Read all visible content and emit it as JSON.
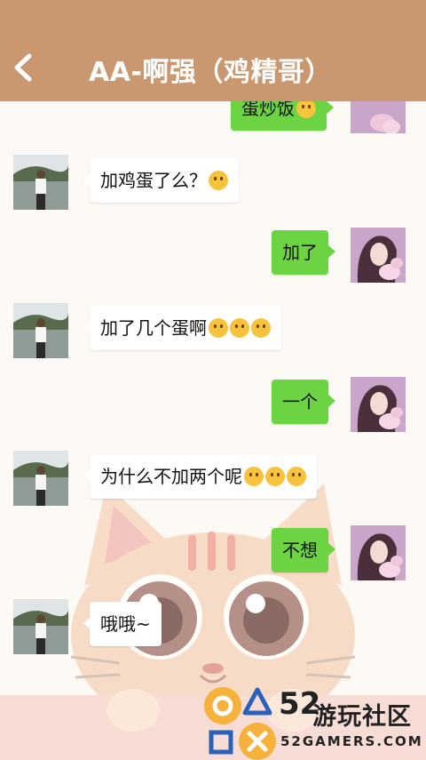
{
  "header": {
    "title": "AA-啊强（鸡精哥）"
  },
  "messages": [
    {
      "side": "right",
      "text": "蛋炒饭"
    },
    {
      "side": "left",
      "text": "加鸡蛋了么？"
    },
    {
      "side": "right",
      "text": "加了"
    },
    {
      "side": "left",
      "text": "加了几个蛋啊"
    },
    {
      "side": "right",
      "text": "一个"
    },
    {
      "side": "left",
      "text": "为什么不加两个呢"
    },
    {
      "side": "right",
      "text": "不想"
    },
    {
      "side": "left",
      "text": "哦哦~"
    }
  ],
  "watermark": {
    "num": "52",
    "cn": "游玩社区",
    "en": "52GAMERS.COM"
  },
  "colors": {
    "header": "#c99770",
    "sent_bubble": "#6cd442",
    "received_bubble": "#ffffff"
  }
}
